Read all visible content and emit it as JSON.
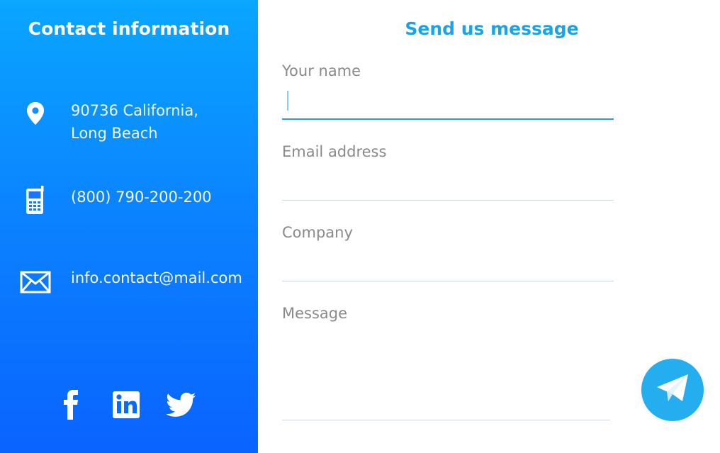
{
  "colors": {
    "left_top": "#0aa6ff",
    "left_bottom": "#0a63ff",
    "accent": "#1aa3e6",
    "send_button": "#24aef0",
    "label_text": "#8a8a8a"
  },
  "contact": {
    "title": "Contact information",
    "address_line1": "90736 California,",
    "address_line2": "Long Beach",
    "phone": "(800) 790-200-200",
    "email": "info.contact@mail.com",
    "icons": {
      "address": "map-pin-icon",
      "phone": "mobile-phone-icon",
      "email": "envelope-icon"
    },
    "social": [
      {
        "name": "facebook-icon"
      },
      {
        "name": "linkedin-icon"
      },
      {
        "name": "twitter-icon"
      }
    ]
  },
  "form": {
    "title": "Send us message",
    "fields": {
      "name": {
        "label": "Your name",
        "value": ""
      },
      "email": {
        "label": "Email address",
        "value": ""
      },
      "company": {
        "label": "Company",
        "value": ""
      },
      "message": {
        "label": "Message",
        "value": ""
      }
    },
    "send_icon": "paper-plane-icon"
  }
}
